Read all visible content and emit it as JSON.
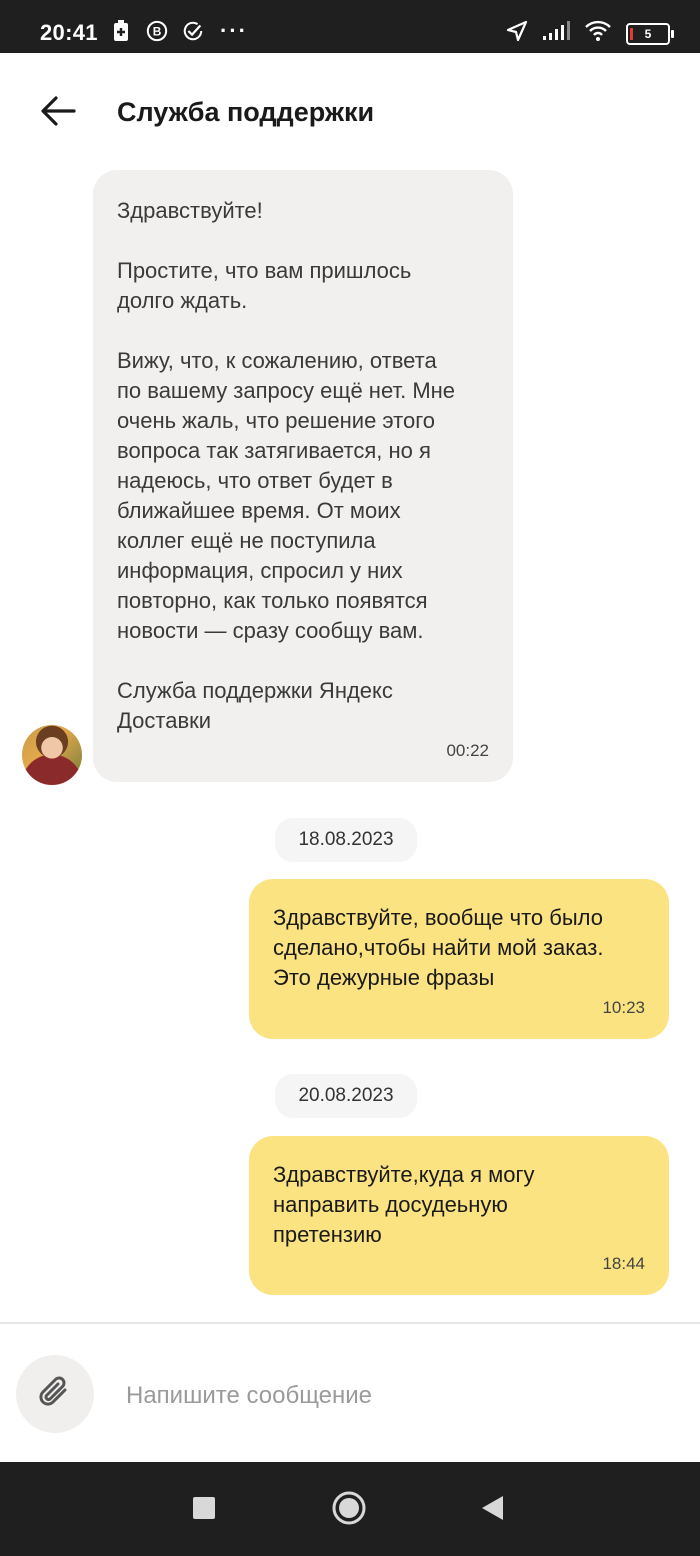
{
  "status_bar": {
    "time": "20:41",
    "dots": "···",
    "battery_level": "5",
    "icons": [
      "battery-saver-icon",
      "b-badge-icon",
      "check-circle-icon",
      "location-arrow-icon",
      "signal-icon",
      "wifi-icon",
      "battery-icon"
    ]
  },
  "header": {
    "title": "Служба поддержки",
    "back_icon": "arrow-left-icon"
  },
  "messages": [
    {
      "from": "support",
      "paragraphs": [
        "Здравствуйте!",
        "Простите, что вам пришлось\nдолго ждать.",
        "Вижу, что, к сожалению, ответа\nпо вашему запросу ещё нет. Мне\nочень жаль, что решение этого\nвопроса так затягивается, но я\nнадеюсь, что ответ будет в\nближайшее время. От моих\nколлег ещё не поступила\nинформация, спросил у них\nповторно, как только появятся\nновости — сразу сообщу вам.",
        "Служба поддержки Яндекс\nДоставки"
      ],
      "time": "00:22"
    },
    {
      "from": "me",
      "date_before": "18.08.2023",
      "text": "Здравствуйте, вообще что было\nсделано,чтобы найти мой заказ.\nЭто дежурные фразы",
      "time": "10:23"
    },
    {
      "from": "me",
      "date_before": "20.08.2023",
      "text": "Здравствуйте,куда я могу\nнаправить досудеьную\nпретензию",
      "time": "18:44"
    }
  ],
  "composer": {
    "placeholder": "Напишите сообщение",
    "attach_icon": "paperclip-icon"
  },
  "nav_bar": {
    "buttons": [
      "square-recents-icon",
      "circle-home-icon",
      "triangle-back-icon"
    ]
  },
  "colors": {
    "status_bar_bg": "#1f1f1f",
    "support_bubble": "#f1f0ee",
    "my_bubble": "#fce382",
    "date_chip": "#f5f5f5"
  }
}
